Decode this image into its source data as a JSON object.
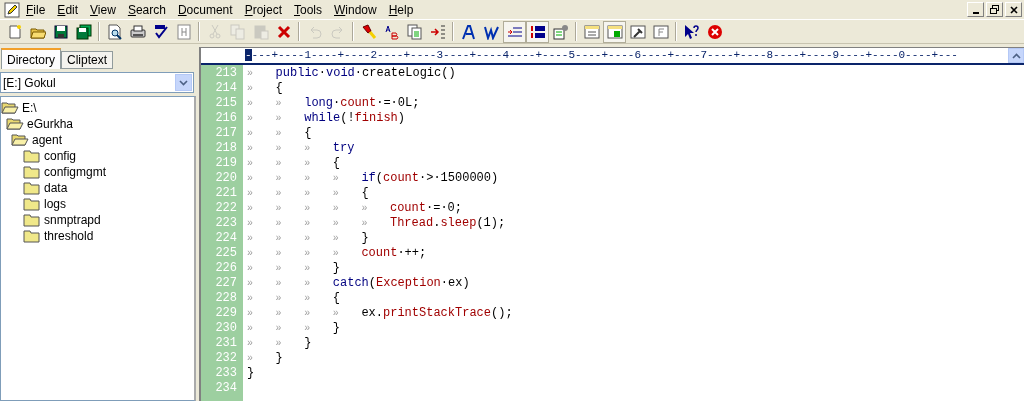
{
  "menu": [
    {
      "label": "File"
    },
    {
      "label": "Edit"
    },
    {
      "label": "View"
    },
    {
      "label": "Search"
    },
    {
      "label": "Document"
    },
    {
      "label": "Project"
    },
    {
      "label": "Tools"
    },
    {
      "label": "Window"
    },
    {
      "label": "Help"
    }
  ],
  "toolbar": [
    {
      "kind": "new",
      "disabled": false,
      "pressed": false
    },
    {
      "kind": "open",
      "disabled": false,
      "pressed": false
    },
    {
      "kind": "save",
      "disabled": false,
      "pressed": false
    },
    {
      "kind": "save-all",
      "disabled": false,
      "pressed": false
    },
    {
      "kind": "separator"
    },
    {
      "kind": "print-preview",
      "disabled": false,
      "pressed": false
    },
    {
      "kind": "print",
      "disabled": false,
      "pressed": false
    },
    {
      "kind": "spell",
      "disabled": false,
      "pressed": false
    },
    {
      "kind": "html",
      "disabled": false,
      "pressed": false
    },
    {
      "kind": "separator"
    },
    {
      "kind": "cut",
      "disabled": true,
      "pressed": false
    },
    {
      "kind": "copy",
      "disabled": true,
      "pressed": false
    },
    {
      "kind": "paste",
      "disabled": true,
      "pressed": false
    },
    {
      "kind": "delete",
      "disabled": false,
      "pressed": false
    },
    {
      "kind": "separator"
    },
    {
      "kind": "undo",
      "disabled": true,
      "pressed": false
    },
    {
      "kind": "redo",
      "disabled": true,
      "pressed": false
    },
    {
      "kind": "separator"
    },
    {
      "kind": "find",
      "disabled": false,
      "pressed": false
    },
    {
      "kind": "replace",
      "disabled": false,
      "pressed": false
    },
    {
      "kind": "pages",
      "disabled": false,
      "pressed": false
    },
    {
      "kind": "indent",
      "disabled": false,
      "pressed": false
    },
    {
      "kind": "separator"
    },
    {
      "kind": "font",
      "disabled": false,
      "pressed": false
    },
    {
      "kind": "word",
      "disabled": false,
      "pressed": false
    },
    {
      "kind": "wrap",
      "disabled": false,
      "pressed": true
    },
    {
      "kind": "line-numbers",
      "disabled": false,
      "pressed": true
    },
    {
      "kind": "settings",
      "disabled": false,
      "pressed": false
    },
    {
      "kind": "separator"
    },
    {
      "kind": "list",
      "disabled": false,
      "pressed": false
    },
    {
      "kind": "panel",
      "disabled": false,
      "pressed": true
    },
    {
      "kind": "tool",
      "disabled": false,
      "pressed": false
    },
    {
      "kind": "frame",
      "disabled": false,
      "pressed": false
    },
    {
      "kind": "separator"
    },
    {
      "kind": "help",
      "disabled": false,
      "pressed": false
    },
    {
      "kind": "stop",
      "disabled": false,
      "pressed": false
    }
  ],
  "sidebar": {
    "tabs": [
      {
        "label": "Directory",
        "selected": true
      },
      {
        "label": "Cliptext",
        "selected": false
      }
    ],
    "drive": "[E:] Gokul",
    "tree": [
      {
        "label": "E:\\",
        "expanded": true,
        "children": [
          {
            "label": "eGurkha",
            "expanded": true,
            "children": [
              {
                "label": "agent",
                "expanded": true,
                "children": [
                  {
                    "label": "config"
                  },
                  {
                    "label": "configmgmt"
                  },
                  {
                    "label": "data"
                  },
                  {
                    "label": "logs"
                  },
                  {
                    "label": "snmptrapd"
                  },
                  {
                    "label": "threshold"
                  }
                ]
              }
            ]
          }
        ]
      }
    ]
  },
  "editor": {
    "ruler": {
      "marker": "-",
      "scale": "---+----1----+----2----+----3----+----4----+----5----+----6----+----7----+----8----+----9----+----0----+---"
    },
    "lines": [
      {
        "number": "213",
        "indent": [
          "»"
        ],
        "tokens": [
          {
            "kind": "keyword",
            "text": "public"
          },
          {
            "kind": "plain",
            "text": "·"
          },
          {
            "kind": "keyword",
            "text": "void"
          },
          {
            "kind": "plain",
            "text": "·createLogic()"
          }
        ]
      },
      {
        "number": "214",
        "indent": [
          "»"
        ],
        "tokens": [
          {
            "kind": "plain",
            "text": "{"
          }
        ]
      },
      {
        "number": "215",
        "indent": [
          "»",
          "»"
        ],
        "tokens": [
          {
            "kind": "keyword",
            "text": "long"
          },
          {
            "kind": "plain",
            "text": "·"
          },
          {
            "kind": "name",
            "text": "count"
          },
          {
            "kind": "plain",
            "text": "·=·0L;"
          }
        ]
      },
      {
        "number": "216",
        "indent": [
          "»",
          "»"
        ],
        "tokens": [
          {
            "kind": "keyword",
            "text": "while"
          },
          {
            "kind": "plain",
            "text": "(!"
          },
          {
            "kind": "name",
            "text": "finish"
          },
          {
            "kind": "plain",
            "text": ")"
          }
        ]
      },
      {
        "number": "217",
        "indent": [
          "»",
          "»"
        ],
        "tokens": [
          {
            "kind": "plain",
            "text": "{"
          }
        ]
      },
      {
        "number": "218",
        "indent": [
          "»",
          "»",
          "»"
        ],
        "tokens": [
          {
            "kind": "keyword",
            "text": "try"
          }
        ]
      },
      {
        "number": "219",
        "indent": [
          "»",
          "»",
          "»"
        ],
        "tokens": [
          {
            "kind": "plain",
            "text": "{"
          }
        ]
      },
      {
        "number": "220",
        "indent": [
          "»",
          "»",
          "»",
          "»"
        ],
        "tokens": [
          {
            "kind": "keyword",
            "text": "if"
          },
          {
            "kind": "plain",
            "text": "("
          },
          {
            "kind": "name",
            "text": "count"
          },
          {
            "kind": "plain",
            "text": "·>·1500000)"
          }
        ]
      },
      {
        "number": "221",
        "indent": [
          "»",
          "»",
          "»",
          "»"
        ],
        "tokens": [
          {
            "kind": "plain",
            "text": "{"
          }
        ]
      },
      {
        "number": "222",
        "indent": [
          "»",
          "»",
          "»",
          "»",
          "»"
        ],
        "tokens": [
          {
            "kind": "name",
            "text": "count"
          },
          {
            "kind": "plain",
            "text": "·=·0;"
          }
        ]
      },
      {
        "number": "223",
        "indent": [
          "»",
          "»",
          "»",
          "»",
          "»"
        ],
        "tokens": [
          {
            "kind": "name",
            "text": "Thread"
          },
          {
            "kind": "plain",
            "text": "."
          },
          {
            "kind": "name",
            "text": "sleep"
          },
          {
            "kind": "plain",
            "text": "(1);"
          }
        ]
      },
      {
        "number": "224",
        "indent": [
          "»",
          "»",
          "»",
          "»"
        ],
        "tokens": [
          {
            "kind": "plain",
            "text": "}"
          }
        ]
      },
      {
        "number": "225",
        "indent": [
          "»",
          "»",
          "»",
          "»"
        ],
        "tokens": [
          {
            "kind": "name",
            "text": "count"
          },
          {
            "kind": "plain",
            "text": "·++;"
          }
        ]
      },
      {
        "number": "226",
        "indent": [
          "»",
          "»",
          "»"
        ],
        "tokens": [
          {
            "kind": "plain",
            "text": "}"
          }
        ]
      },
      {
        "number": "227",
        "indent": [
          "»",
          "»",
          "»"
        ],
        "tokens": [
          {
            "kind": "keyword",
            "text": "catch"
          },
          {
            "kind": "plain",
            "text": "("
          },
          {
            "kind": "name",
            "text": "Exception"
          },
          {
            "kind": "plain",
            "text": "·ex)"
          }
        ]
      },
      {
        "number": "228",
        "indent": [
          "»",
          "»",
          "»"
        ],
        "tokens": [
          {
            "kind": "plain",
            "text": "{"
          }
        ]
      },
      {
        "number": "229",
        "indent": [
          "»",
          "»",
          "»",
          "»"
        ],
        "tokens": [
          {
            "kind": "plain",
            "text": "ex."
          },
          {
            "kind": "name",
            "text": "printStackTrace"
          },
          {
            "kind": "plain",
            "text": "();"
          }
        ]
      },
      {
        "number": "230",
        "indent": [
          "»",
          "»",
          "»"
        ],
        "tokens": [
          {
            "kind": "plain",
            "text": "}"
          }
        ]
      },
      {
        "number": "231",
        "indent": [
          "»",
          "»"
        ],
        "tokens": [
          {
            "kind": "plain",
            "text": "}"
          }
        ]
      },
      {
        "number": "232",
        "indent": [
          "»"
        ],
        "tokens": [
          {
            "kind": "plain",
            "text": "}"
          }
        ]
      },
      {
        "number": "233",
        "tokens": [
          {
            "kind": "plain",
            "text": "}"
          }
        ]
      },
      {
        "number": "234"
      }
    ]
  }
}
